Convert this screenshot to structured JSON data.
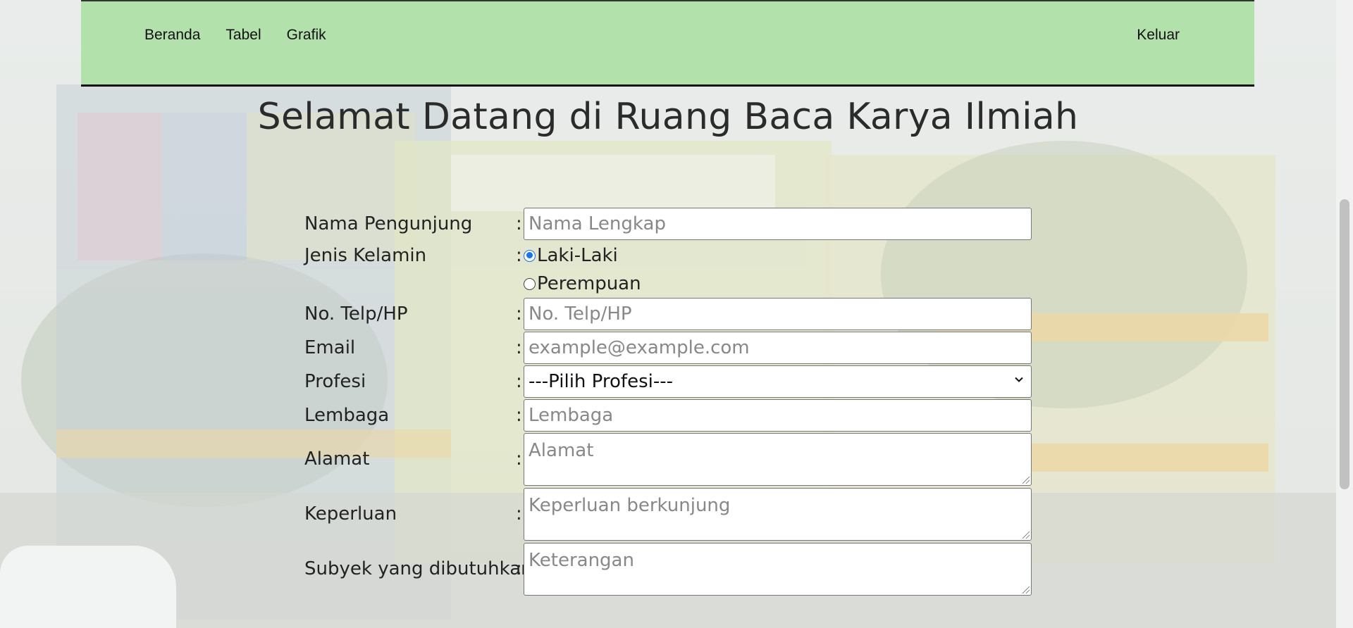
{
  "nav": {
    "items": [
      "Beranda",
      "Tabel",
      "Grafik"
    ],
    "logout": "Keluar"
  },
  "page_title": "Selamat Datang di Ruang Baca Karya Ilmiah",
  "form": {
    "colon": ":",
    "name": {
      "label": "Nama Pengunjung",
      "placeholder": "Nama Lengkap"
    },
    "gender": {
      "label": "Jenis Kelamin",
      "options": [
        "Laki-Laki",
        "Perempuan"
      ],
      "selected": "Laki-Laki"
    },
    "phone": {
      "label": "No. Telp/HP",
      "placeholder": "No. Telp/HP"
    },
    "email": {
      "label": "Email",
      "placeholder": "example@example.com"
    },
    "profession": {
      "label": "Profesi",
      "value": "---Pilih Profesi---"
    },
    "institution": {
      "label": "Lembaga",
      "placeholder": "Lembaga"
    },
    "address": {
      "label": "Alamat",
      "placeholder": "Alamat"
    },
    "purpose": {
      "label": "Keperluan",
      "placeholder": "Keperluan berkunjung"
    },
    "subject": {
      "label": "Subyek yang dibutuhkan",
      "placeholder": "Keterangan"
    }
  },
  "colors": {
    "navbar": "#b3e1ac",
    "radio_accent": "#1a73e8"
  }
}
